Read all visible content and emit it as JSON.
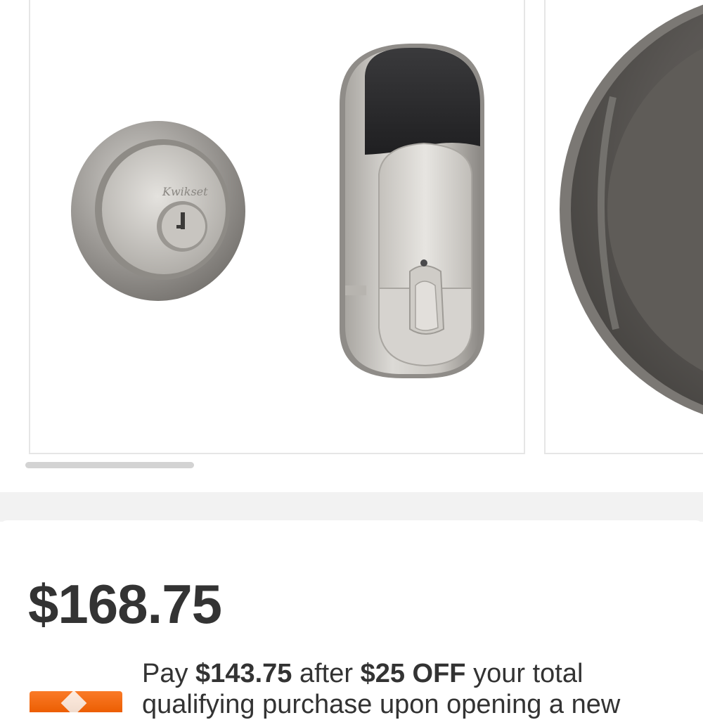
{
  "product": {
    "brand_engraving": "Kwikset",
    "price": "$168.75",
    "promo": {
      "prefix": "Pay ",
      "discounted_price": "$143.75",
      "middle": " after ",
      "discount": "$25 OFF",
      "suffix": " your total qualifying purchase upon opening a new"
    }
  },
  "gallery": {
    "current_image": 1,
    "images": [
      "deadbolt-and-smart-lock",
      "smart-lock-closeup"
    ]
  },
  "colors": {
    "brand_orange": "#f96302",
    "text": "#333333",
    "card_border": "#e6e6e6",
    "scrollbar": "#d3d3d3"
  }
}
